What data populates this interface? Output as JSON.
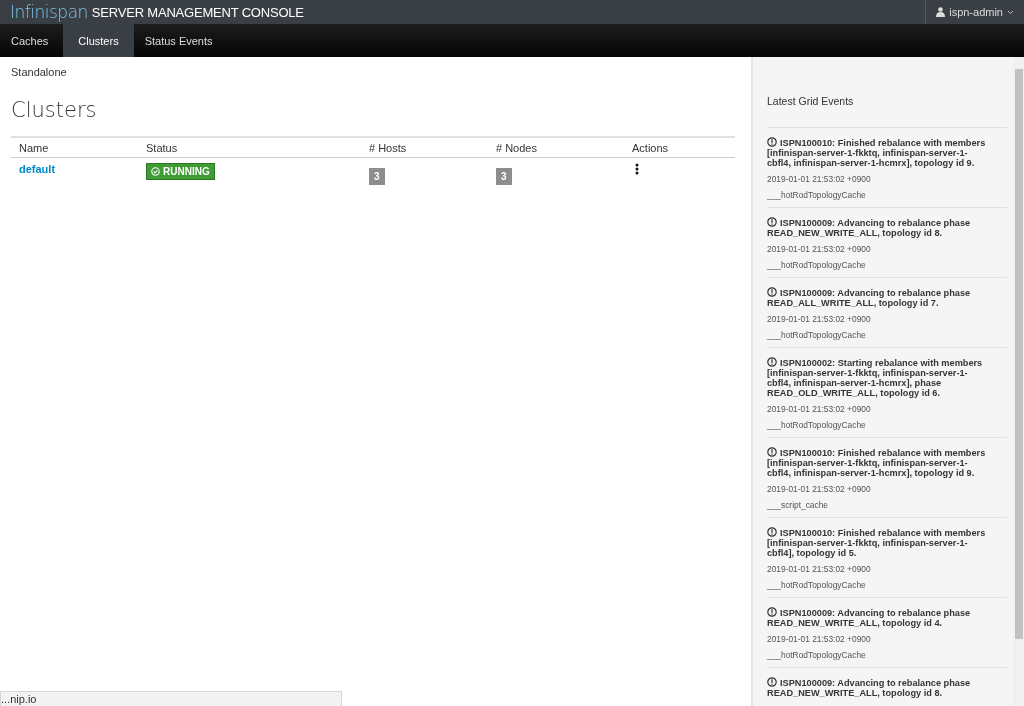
{
  "header": {
    "logo": "Infinispan",
    "title": "SERVER MANAGEMENT CONSOLE",
    "user": "ispn-admin"
  },
  "tabs": [
    {
      "label": "Caches",
      "selected": false
    },
    {
      "label": "Clusters",
      "selected": true
    },
    {
      "label": "Status Events",
      "selected": false
    }
  ],
  "breadcrumb": "Standalone",
  "heading": "Clusters",
  "table": {
    "columns": [
      "Name",
      "Status",
      "# Hosts",
      "# Nodes",
      "Actions"
    ],
    "rows": [
      {
        "name": "default",
        "status": "RUNNING",
        "hosts": "3",
        "nodes": "3"
      }
    ]
  },
  "events_panel": {
    "title": "Latest Grid Events",
    "events": [
      {
        "message": "ISPN100010: Finished rebalance with members [infinispan-server-1-fkktq, infinispan-server-1-cbfl4, infinispan-server-1-hcmrx], topology id 9.",
        "time": "2019-01-01 21:53:02 +0900",
        "cache": "___hotRodTopologyCache"
      },
      {
        "message": "ISPN100009: Advancing to rebalance phase READ_NEW_WRITE_ALL, topology id 8.",
        "time": "2019-01-01 21:53:02 +0900",
        "cache": "___hotRodTopologyCache"
      },
      {
        "message": "ISPN100009: Advancing to rebalance phase READ_ALL_WRITE_ALL, topology id 7.",
        "time": "2019-01-01 21:53:02 +0900",
        "cache": "___hotRodTopologyCache"
      },
      {
        "message": "ISPN100002: Starting rebalance with members [infinispan-server-1-fkktq, infinispan-server-1-cbfl4, infinispan-server-1-hcmrx], phase READ_OLD_WRITE_ALL, topology id 6.",
        "time": "2019-01-01 21:53:02 +0900",
        "cache": "___hotRodTopologyCache"
      },
      {
        "message": "ISPN100010: Finished rebalance with members [infinispan-server-1-fkktq, infinispan-server-1-cbfl4, infinispan-server-1-hcmrx], topology id 9.",
        "time": "2019-01-01 21:53:02 +0900",
        "cache": "___script_cache"
      },
      {
        "message": "ISPN100010: Finished rebalance with members [infinispan-server-1-fkktq, infinispan-server-1-cbfl4], topology id 5.",
        "time": "2019-01-01 21:53:02 +0900",
        "cache": "___hotRodTopologyCache"
      },
      {
        "message": "ISPN100009: Advancing to rebalance phase READ_NEW_WRITE_ALL, topology id 4.",
        "time": "2019-01-01 21:53:02 +0900",
        "cache": "___hotRodTopologyCache"
      },
      {
        "message": "ISPN100009: Advancing to rebalance phase READ_NEW_WRITE_ALL, topology id 8."
      }
    ]
  },
  "status_bar": "...nip.io"
}
